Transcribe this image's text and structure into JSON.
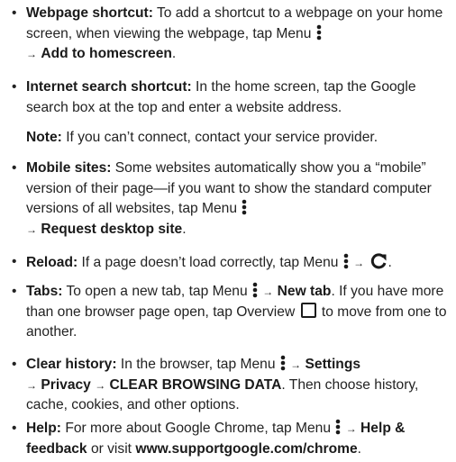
{
  "bullet_glyph": "•",
  "arrow_glyph": "→",
  "webpage_shortcut": {
    "term": "Webpage shortcut:",
    "text_1": " To add a shortcut to a webpage on your home screen, when viewing the webpage, tap Menu ",
    "text_2": " ",
    "bold_1": "Add to homescreen",
    "end": "."
  },
  "internet_search": {
    "term": "Internet search shortcut:",
    "text": " In the home screen, tap the Google search box at the top and enter a website address."
  },
  "note": {
    "term": "Note:",
    "text": " If you can’t connect, contact your service provider."
  },
  "mobile_sites": {
    "term": "Mobile sites:",
    "text_1": " Some websites automatically show you a “mobile” version of their page—if you want to show the standard computer versions of all websites, tap Menu ",
    "bold_1": "Request desktop site",
    "end": "."
  },
  "reload": {
    "term": "Reload:",
    "text_1": " If a page doesn’t load correctly, tap Menu ",
    "end": "."
  },
  "tabs": {
    "term": "Tabs:",
    "text_1": " To open a new tab, tap Menu ",
    "bold_1": "New tab",
    "text_2": ". If you have more than one browser page open, tap Overview ",
    "text_3": " to move from one to another."
  },
  "clear_history": {
    "term": "Clear history:",
    "text_1": " In the browser, tap Menu ",
    "bold_1": "Settings",
    "bold_2": "Privacy",
    "bold_3": "CLEAR BROWSING DATA",
    "text_2": ". Then choose history, cache, cookies, and other options."
  },
  "help": {
    "term": "Help:",
    "text_1": " For more about Google Chrome, tap Menu ",
    "bold_1": "Help & feedback",
    "text_2": " or visit ",
    "bold_2": "www.supportgoogle.com/chrome",
    "end": "."
  }
}
